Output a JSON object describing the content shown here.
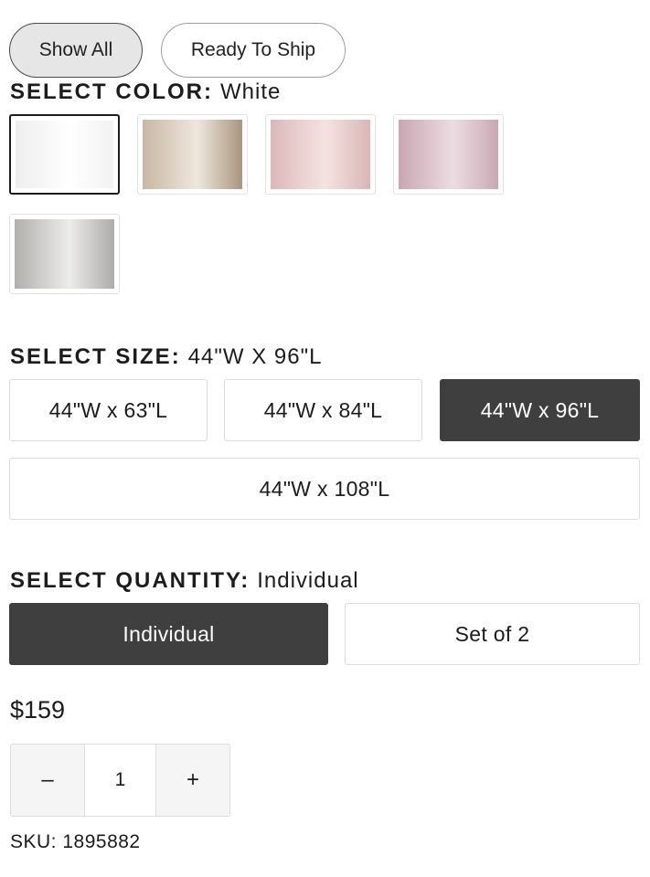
{
  "filters": {
    "show_all": "Show All",
    "ready_to_ship": "Ready To Ship"
  },
  "color": {
    "label": "SELECT COLOR",
    "colon": ":",
    "selected": "White",
    "swatches": [
      {
        "name": "white",
        "gradient": [
          "#eeeeee",
          "#ffffff",
          "#f2f2f2"
        ]
      },
      {
        "name": "taupe",
        "gradient": [
          "#c8b7a4",
          "#efe7dc",
          "#a99580"
        ]
      },
      {
        "name": "blush",
        "gradient": [
          "#dcb8b8",
          "#f4e4e1",
          "#d9b6b5"
        ]
      },
      {
        "name": "mauve",
        "gradient": [
          "#c8a7b2",
          "#ecdde2",
          "#c8a8b3"
        ]
      },
      {
        "name": "silver",
        "gradient": [
          "#b2afac",
          "#ececeb",
          "#aeaca9"
        ]
      }
    ]
  },
  "size": {
    "label": "SELECT SIZE",
    "colon": ":",
    "selected": "44\"W X 96\"L",
    "options": [
      "44\"W x 63\"L",
      "44\"W x 84\"L",
      "44\"W x 96\"L",
      "44\"W x 108\"L"
    ]
  },
  "quantity": {
    "label": "SELECT QUANTITY",
    "colon": ":",
    "selected": "Individual",
    "options": [
      "Individual",
      "Set of 2"
    ]
  },
  "price": "$159",
  "stepper": {
    "minus": "–",
    "value": "1",
    "plus": "+"
  },
  "sku": "SKU: 1895882",
  "colors": {
    "selected_bg": "#3f3f3f",
    "border": "#dcdcdc",
    "text": "#1c1c1c"
  }
}
